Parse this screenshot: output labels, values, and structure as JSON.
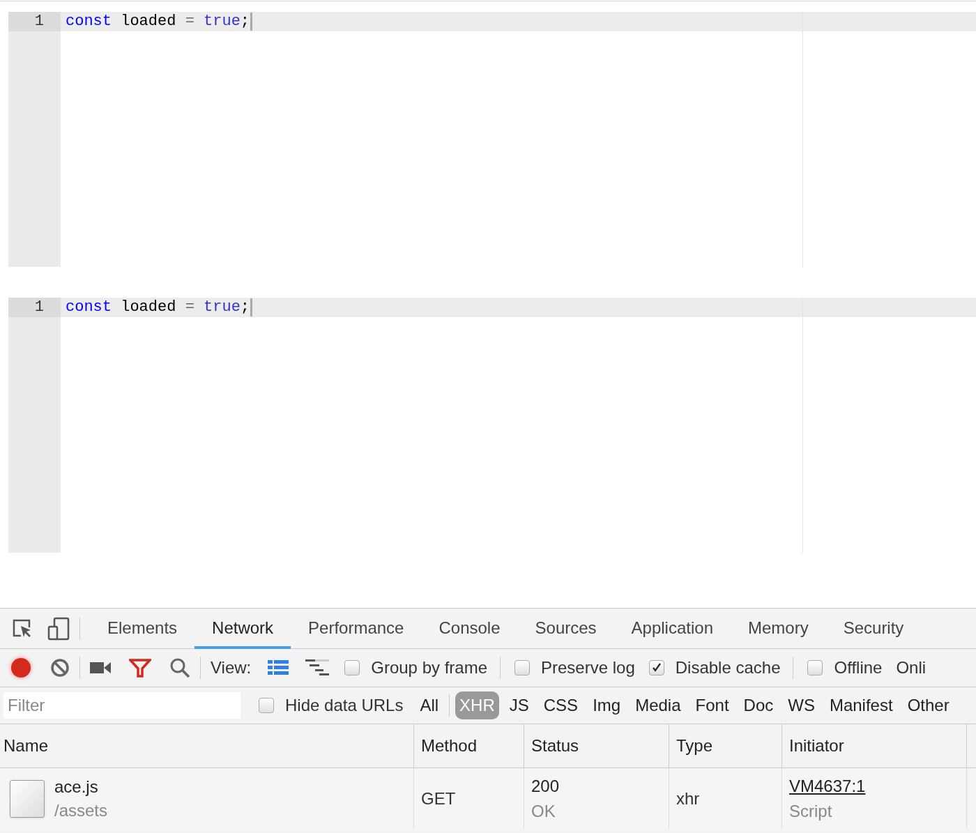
{
  "editors": [
    {
      "lines": [
        {
          "number": "1",
          "active": true,
          "tokens": [
            {
              "kind": "keyword",
              "text": "const"
            },
            {
              "kind": "plain",
              "text": " loaded "
            },
            {
              "kind": "operator",
              "text": "= "
            },
            {
              "kind": "constant",
              "text": "true"
            },
            {
              "kind": "plain",
              "text": ";"
            }
          ]
        }
      ]
    },
    {
      "lines": [
        {
          "number": "1",
          "active": true,
          "tokens": [
            {
              "kind": "keyword",
              "text": "const"
            },
            {
              "kind": "plain",
              "text": " loaded "
            },
            {
              "kind": "operator",
              "text": "= "
            },
            {
              "kind": "constant",
              "text": "true"
            },
            {
              "kind": "plain",
              "text": ";"
            }
          ]
        }
      ]
    }
  ],
  "devtools": {
    "tabs": [
      {
        "label": "Elements",
        "selected": false
      },
      {
        "label": "Network",
        "selected": true
      },
      {
        "label": "Performance",
        "selected": false
      },
      {
        "label": "Console",
        "selected": false
      },
      {
        "label": "Sources",
        "selected": false
      },
      {
        "label": "Application",
        "selected": false
      },
      {
        "label": "Memory",
        "selected": false
      },
      {
        "label": "Security",
        "selected": false
      }
    ],
    "toolbar": {
      "recording": true,
      "view_label": "View:",
      "options": [
        {
          "label": "Group by frame",
          "checked": false
        },
        {
          "label": "Preserve log",
          "checked": false
        },
        {
          "label": "Disable cache",
          "checked": true
        },
        {
          "label": "Offline",
          "checked": false
        }
      ],
      "throttle": "Onli"
    },
    "filter": {
      "placeholder": "Filter",
      "hide_data_urls": {
        "label": "Hide data URLs",
        "checked": false
      },
      "types": [
        {
          "label": "All",
          "selected": false
        },
        {
          "label": "XHR",
          "selected": true
        },
        {
          "label": "JS",
          "selected": false
        },
        {
          "label": "CSS",
          "selected": false
        },
        {
          "label": "Img",
          "selected": false
        },
        {
          "label": "Media",
          "selected": false
        },
        {
          "label": "Font",
          "selected": false
        },
        {
          "label": "Doc",
          "selected": false
        },
        {
          "label": "WS",
          "selected": false
        },
        {
          "label": "Manifest",
          "selected": false
        },
        {
          "label": "Other",
          "selected": false
        }
      ]
    },
    "table": {
      "columns": [
        "Name",
        "Method",
        "Status",
        "Type",
        "Initiator"
      ],
      "rows": [
        {
          "name": "ace.js",
          "path": "/assets",
          "method": "GET",
          "status": "200",
          "status_text": "OK",
          "type": "xhr",
          "initiator": "VM4637:1",
          "initiator_type": "Script"
        }
      ]
    }
  }
}
